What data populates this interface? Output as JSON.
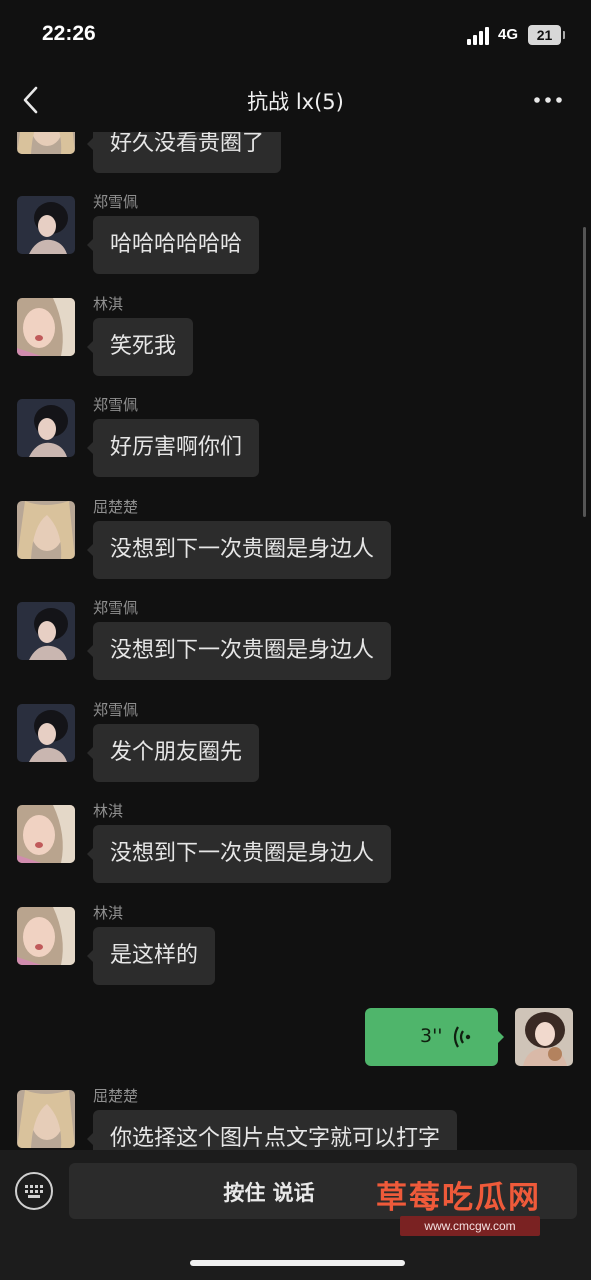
{
  "status": {
    "time": "22:26",
    "network": "4G",
    "battery": "21"
  },
  "nav": {
    "title": "抗战 lx(5)"
  },
  "messages": [
    {
      "sender": "",
      "text": "好久没看贵圈了"
    },
    {
      "sender": "郑雪佩",
      "text": "哈哈哈哈哈哈"
    },
    {
      "sender": "林淇",
      "text": "笑死我"
    },
    {
      "sender": "郑雪佩",
      "text": "好厉害啊你们"
    },
    {
      "sender": "屈楚楚",
      "text": "没想到下一次贵圈是身边人"
    },
    {
      "sender": "郑雪佩",
      "text": "没想到下一次贵圈是身边人"
    },
    {
      "sender": "郑雪佩",
      "text": "发个朋友圈先"
    },
    {
      "sender": "林淇",
      "text": "没想到下一次贵圈是身边人"
    },
    {
      "sender": "林淇",
      "text": "是这样的"
    },
    {
      "sender": "屈楚楚",
      "text": "你选择这个图片点文字就可以打字"
    }
  ],
  "voice_message": {
    "duration": "3''"
  },
  "input": {
    "hold_to_talk": "按住 说话"
  },
  "watermark": {
    "title": "草莓吃瓜网",
    "url": "www.cmcgw.com"
  },
  "colors": {
    "background": "#111111",
    "bubble": "#2c2c2c",
    "voice_bubble": "#4fb56b",
    "watermark": "#ef5a3a"
  }
}
